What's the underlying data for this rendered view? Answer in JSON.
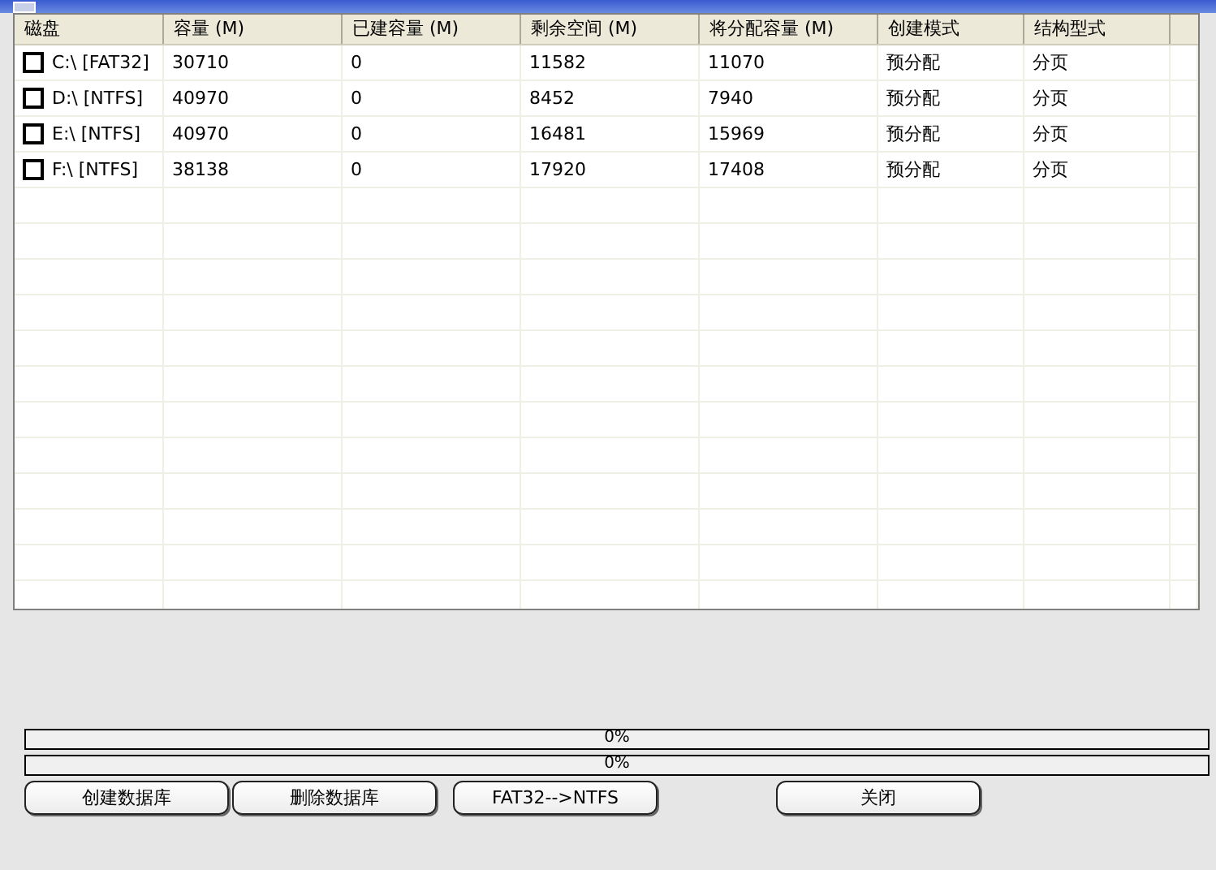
{
  "table": {
    "columns": [
      "磁盘",
      "容量 (M)",
      "已建容量 (M)",
      "剩余空间 (M)",
      "将分配容量 (M)",
      "创建模式",
      "结构型式"
    ],
    "rows": [
      {
        "checked": false,
        "cells": [
          "C:\\  [FAT32]",
          "30710",
          "0",
          "11582",
          "11070",
          "预分配",
          "分页"
        ]
      },
      {
        "checked": false,
        "cells": [
          "D:\\  [NTFS]",
          "40970",
          "0",
          "8452",
          "7940",
          "预分配",
          "分页"
        ]
      },
      {
        "checked": false,
        "cells": [
          "E:\\  [NTFS]",
          "40970",
          "0",
          "16481",
          "15969",
          "预分配",
          "分页"
        ]
      },
      {
        "checked": false,
        "cells": [
          "F:\\  [NTFS]",
          "38138",
          "0",
          "17920",
          "17408",
          "预分配",
          "分页"
        ]
      }
    ]
  },
  "progress": [
    {
      "level": 0,
      "reading": "0%"
    },
    {
      "level": 0,
      "reading": "0%"
    }
  ],
  "buttons": [
    "创建数据库",
    "删除数据库",
    "FAT32-->NTFS",
    "关闭"
  ]
}
